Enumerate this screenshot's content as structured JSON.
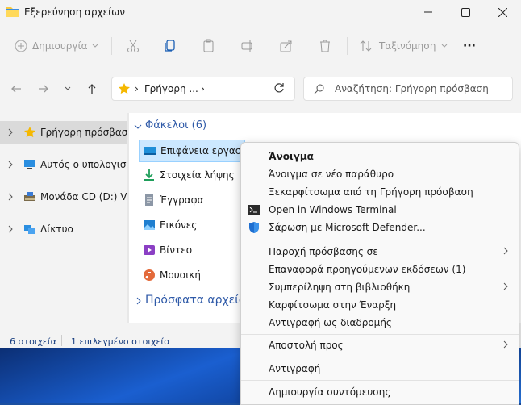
{
  "window": {
    "title": "Εξερεύνηση αρχείων"
  },
  "toolbar": {
    "new_label": "Δημιουργία",
    "sort_label": "Ταξινόμηση",
    "more_label": "···"
  },
  "address": {
    "path": "Γρήγορη ...",
    "separator": "›"
  },
  "search": {
    "placeholder": "Αναζήτηση: Γρήγορη πρόσβαση"
  },
  "sidebar": {
    "items": [
      {
        "label": "Γρήγορη πρόσβαση",
        "icon": "star-icon"
      },
      {
        "label": "Αυτός ο υπολογιστ",
        "icon": "computer-icon"
      },
      {
        "label": "Μονάδα CD (D:) Virt",
        "icon": "cd-drive-icon"
      },
      {
        "label": "Δίκτυο",
        "icon": "network-icon"
      }
    ]
  },
  "content": {
    "folders_header": "Φάκελοι (6)",
    "folders": [
      {
        "label": "Επιφάνεια εργασίας",
        "icon": "desktop-icon"
      },
      {
        "label": "Στοιχεία λήψης",
        "icon": "download-icon"
      },
      {
        "label": "Έγγραφα",
        "icon": "document-icon"
      },
      {
        "label": "Εικόνες",
        "icon": "pictures-icon"
      },
      {
        "label": "Βίντεο",
        "icon": "video-icon"
      },
      {
        "label": "Μουσική",
        "icon": "music-icon"
      }
    ],
    "recent_header": "Πρόσφατα αρχεία"
  },
  "status": {
    "count": "6 στοιχεία",
    "selected": "1 επιλεγμένο στοιχείο"
  },
  "context_menu": {
    "items": [
      {
        "label": "Άνοιγμα"
      },
      {
        "label": "Άνοιγμα σε νέο παράθυρο"
      },
      {
        "label": "Ξεκαρφίτσωμα από τη Γρήγορη πρόσβαση"
      },
      {
        "label": "Open in Windows Terminal"
      },
      {
        "label": "Σάρωση με Microsoft Defender..."
      },
      {
        "label": "Παροχή πρόσβασης σε"
      },
      {
        "label": "Επαναφορά προηγούμενων εκδόσεων (1)"
      },
      {
        "label": "Συμπερίληψη στη βιβλιοθήκη"
      },
      {
        "label": "Καρφίτσωμα στην Έναρξη"
      },
      {
        "label": "Αντιγραφή ως διαδρομής"
      },
      {
        "label": "Αποστολή προς"
      },
      {
        "label": "Αντιγραφή"
      },
      {
        "label": "Δημιουργία συντόμευσης"
      }
    ]
  },
  "colors": {
    "accent": "#2f5aa8",
    "selection": "#cce8ff",
    "folder": "#f8c93e"
  }
}
